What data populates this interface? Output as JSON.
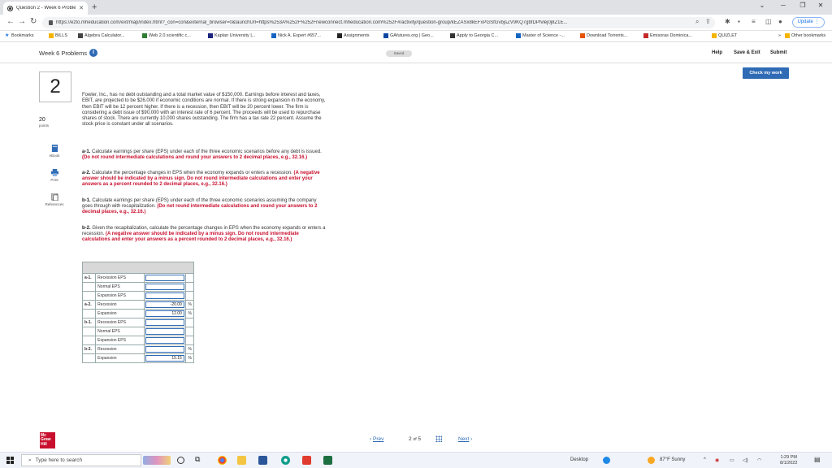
{
  "browser": {
    "tab_title": "Question 2 - Week 6 Problems - ...",
    "new_tab_symbol": "+",
    "url": "https://ezto.mheducation.com/ext/map/index.html?_con=con&external_browser=0&launchUrl=https%253A%252F%252Fnewconnect.mheducation.com%252F#/activity/question-group/kEZASx8kEFxPGSfGvbjsZV9KQ7gbfDPfvlej0j8Z1E...",
    "update_label": "Update",
    "bookmarks": [
      {
        "label": "Bookmarks",
        "color": "#1a73e8"
      },
      {
        "label": "BILLS",
        "color": "#f4b400"
      },
      {
        "label": "Algebra Calculator...",
        "color": "#444444"
      },
      {
        "label": "Web 2.0 scientific c...",
        "color": "#2e7d32"
      },
      {
        "label": "Kaplan University |...",
        "color": "#1a237e"
      },
      {
        "label": "Nick A. Expert #657...",
        "color": "#1565c0"
      },
      {
        "label": "Assignments",
        "color": "#222222"
      },
      {
        "label": "GAfutures.org | Geo...",
        "color": "#0d47a1"
      },
      {
        "label": "Apply to Georgia C...",
        "color": "#333333"
      },
      {
        "label": "Master of Science -...",
        "color": "#1565c0"
      },
      {
        "label": "Download Torrents...",
        "color": "#e65100"
      },
      {
        "label": "Emisoras Dominica...",
        "color": "#c62828"
      },
      {
        "label": "QUIZLET",
        "color": "#f4b400"
      }
    ],
    "bookmarks_overflow": "»",
    "other_bookmarks": "Other bookmarks"
  },
  "header": {
    "title": "Week 6 Problems",
    "saved": "Saved",
    "help": "Help",
    "save_exit": "Save & Exit",
    "submit": "Submit",
    "check": "Check my work"
  },
  "sidebar": {
    "question_number": "2",
    "points": "20",
    "points_label": "points",
    "tools": [
      "eBook",
      "Print",
      "References"
    ]
  },
  "question": {
    "text": "Fowler, Inc., has no debt outstanding and a total market value of $150,000. Earnings before interest and taxes, EBIT, are projected to be $26,000 if economic conditions are normal. If there is strong expansion in the economy, then EBIT will be 12 percent higher. If there is a recession, then EBIT will be 20 percent lower. The firm is considering a debt issue of $90,000 with an interest rate of 6 percent. The proceeds will be used to repurchase shares of stock. There are currently 10,000 shares outstanding. The firm has a tax rate 22 percent. Assume the stock price is constant under all scenarios.",
    "parts": [
      {
        "label": "a-1.",
        "text": "Calculate earnings per share (EPS) under each of the three economic scenarios before any debt is issued.",
        "note": "(Do not round intermediate calculations and round your answers to 2 decimal places, e.g., 32.16.)"
      },
      {
        "label": "a-2.",
        "text": "Calculate the percentage changes in EPS when the economy expands or enters a recession.",
        "note": "(A negative answer should be indicated by a minus sign. Do not round intermediate calculations and enter your answers as a percent rounded to 2 decimal places, e.g., 32.16.)"
      },
      {
        "label": "b-1.",
        "text": "Calculate earnings per share (EPS) under each of the three economic scenarios assuming the company goes through with recapitalization.",
        "note": "(Do not round intermediate calculations and round your answers to 2 decimal places, e.g., 32.16.)"
      },
      {
        "label": "b-2.",
        "text": "Given the recapitalization, calculate the percentage changes in EPS when the economy expands or enters a recession.",
        "note": "(A negative answer should be indicated by a minus sign. Do not round intermediate calculations and enter your answers as a percent rounded to 2 decimal places, e.g., 32.16.)"
      }
    ]
  },
  "answer_table": {
    "rows": [
      {
        "part": "a-1.",
        "label": "Recession EPS",
        "value": "",
        "unit": ""
      },
      {
        "part": "",
        "label": "Normal EPS",
        "value": "",
        "unit": ""
      },
      {
        "part": "",
        "label": "Expansion EPS",
        "value": "",
        "unit": ""
      },
      {
        "part": "a-2.",
        "label": "Recession",
        "value": "-20.00",
        "unit": "%"
      },
      {
        "part": "",
        "label": "Expansion",
        "value": "12.00",
        "unit": "%"
      },
      {
        "part": "b-1.",
        "label": "Recession EPS",
        "value": "",
        "unit": ""
      },
      {
        "part": "",
        "label": "Normal EPS",
        "value": "",
        "unit": ""
      },
      {
        "part": "",
        "label": "Expansion EPS",
        "value": "",
        "unit": ""
      },
      {
        "part": "b-2.",
        "label": "Recession",
        "value": "",
        "unit": "%"
      },
      {
        "part": "",
        "label": "Expansion",
        "value": "15.15",
        "unit": "%"
      }
    ]
  },
  "footer": {
    "logo": "Mc Graw Hill",
    "prev": "Prev",
    "page_current": "2",
    "page_of": "of",
    "page_total": "5",
    "next": "Next"
  },
  "taskbar": {
    "search_placeholder": "Type here to search",
    "desktop": "Desktop",
    "weather": "87°F  Sunny",
    "time": "1:29 PM",
    "date": "8/1/2022"
  }
}
